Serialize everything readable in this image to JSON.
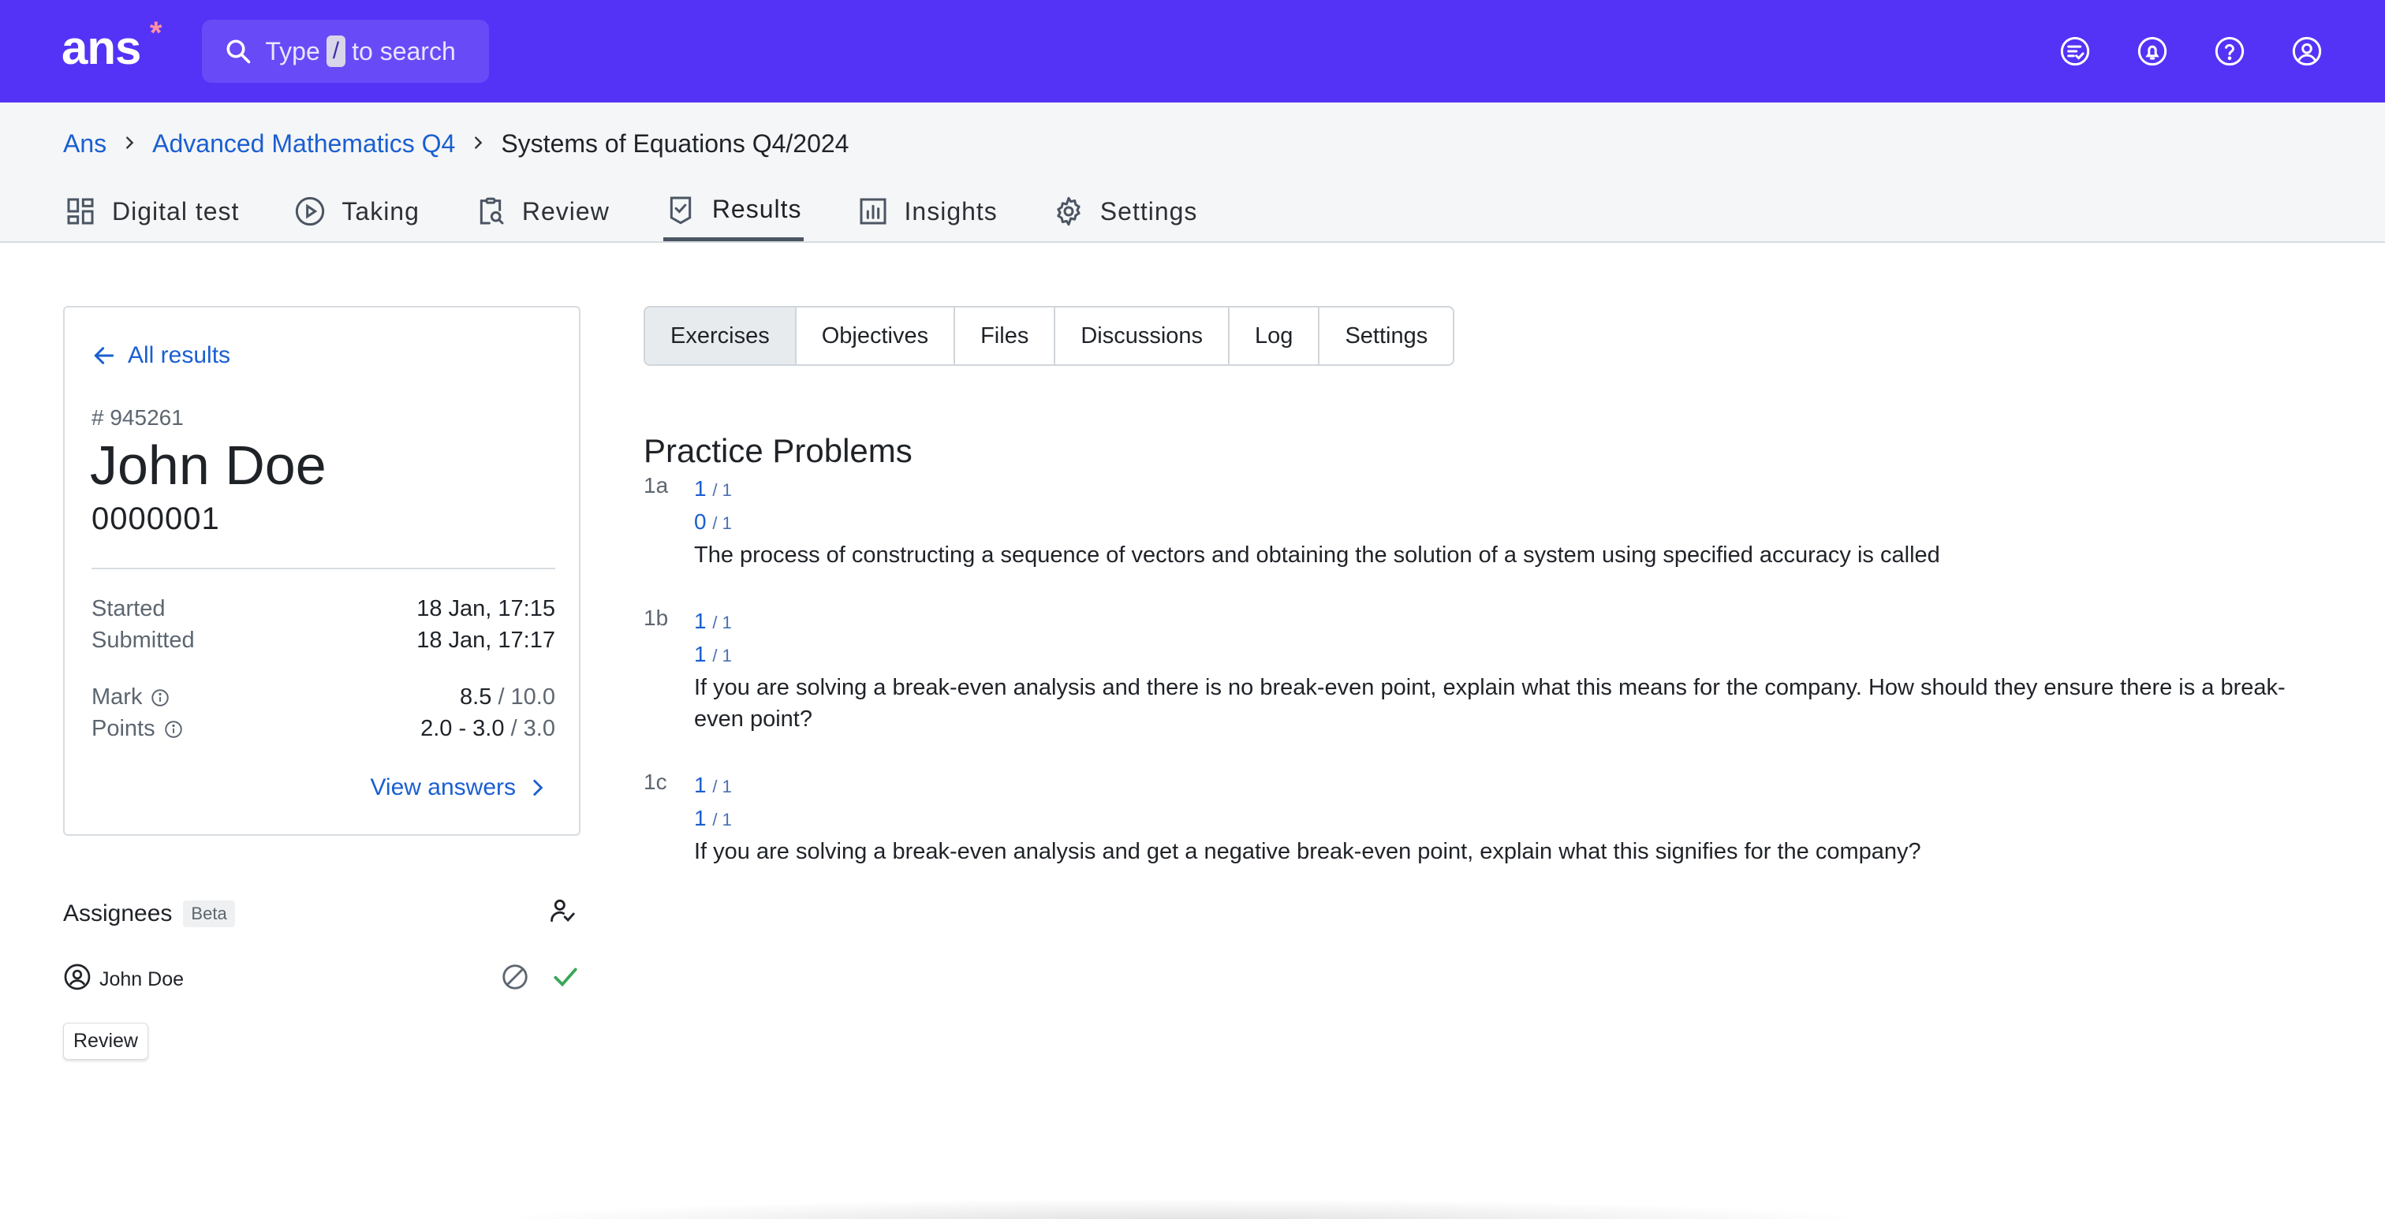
{
  "app": {
    "logo": "ans",
    "logo_mark": "*"
  },
  "search": {
    "pre": "Type",
    "key": "/",
    "post": "to search"
  },
  "top_icons": [
    "task-list-icon",
    "bell-icon",
    "help-icon",
    "account-icon"
  ],
  "breadcrumb": [
    {
      "label": "Ans"
    },
    {
      "label": "Advanced Mathematics Q4"
    },
    {
      "label": "Systems of Equations Q4/2024"
    }
  ],
  "tabs": [
    {
      "label": "Digital test",
      "icon": "grid-icon"
    },
    {
      "label": "Taking",
      "icon": "play-circle-icon"
    },
    {
      "label": "Review",
      "icon": "clipboard-search-icon"
    },
    {
      "label": "Results",
      "icon": "badge-check-icon",
      "active": true
    },
    {
      "label": "Insights",
      "icon": "bar-chart-icon"
    },
    {
      "label": "Settings",
      "icon": "gear-icon"
    }
  ],
  "result": {
    "back_label": "All results",
    "id": "# 945261",
    "name": "John Doe",
    "number": "0000001",
    "started_label": "Started",
    "started_value": "18 Jan, 17:15",
    "submitted_label": "Submitted",
    "submitted_value": "18 Jan, 17:17",
    "mark_label": "Mark",
    "mark_value": "8.5",
    "mark_out_of": "/ 10.0",
    "points_label": "Points",
    "points_value": "2.0 - 3.0",
    "points_out_of": "/ 3.0",
    "view_answers": "View answers"
  },
  "assignees": {
    "title": "Assignees",
    "badge": "Beta",
    "person": "John Doe",
    "review_button": "Review"
  },
  "subtabs": [
    {
      "label": "Exercises",
      "active": true
    },
    {
      "label": "Objectives"
    },
    {
      "label": "Files"
    },
    {
      "label": "Discussions"
    },
    {
      "label": "Log"
    },
    {
      "label": "Settings"
    }
  ],
  "section_title": "Practice Problems",
  "exercises": [
    {
      "num": "1a",
      "score1": "1",
      "of1": "/ 1",
      "score2": "0",
      "of2": "/ 1",
      "text": "The process of constructing a sequence of vectors and obtaining the solution of a system using specified accuracy is called"
    },
    {
      "num": "1b",
      "score1": "1",
      "of1": "/ 1",
      "score2": "1",
      "of2": "/ 1",
      "text": "If you are solving a break-even analysis and there is no break-even point, explain what this means for the company. How should they ensure there is a break-even point?"
    },
    {
      "num": "1c",
      "score1": "1",
      "of1": "/ 1",
      "score2": "1",
      "of2": "/ 1",
      "text": "If you are solving a break-even analysis and get a negative break-even point, explain what this signifies for the company?"
    }
  ]
}
